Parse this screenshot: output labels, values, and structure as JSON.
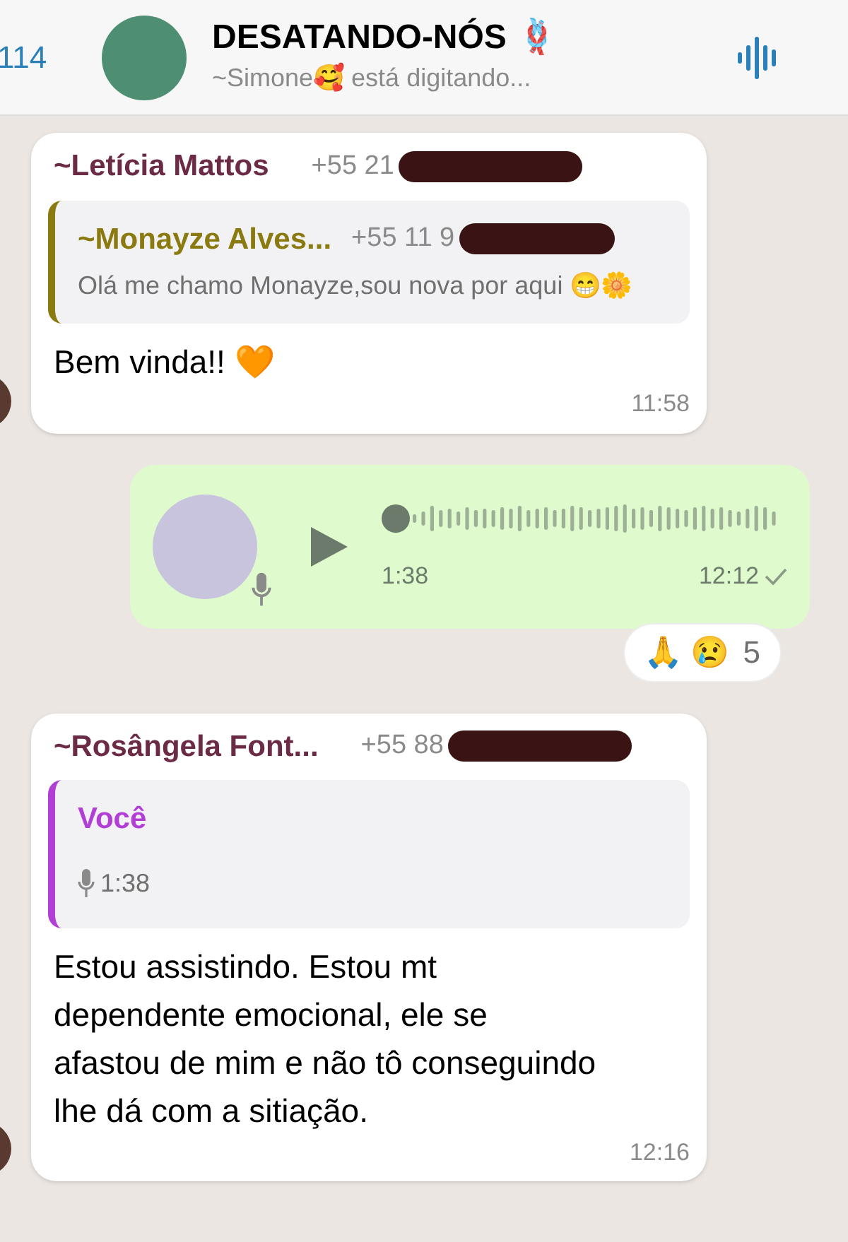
{
  "header": {
    "back_count": "114",
    "title": "DESATANDO-NÓS 🪢",
    "subtitle": "~Simone🥰 está digitando..."
  },
  "messages": [
    {
      "kind": "text",
      "sender": "~Letícia Mattos",
      "phone": "+55 21",
      "quote": {
        "sender": "~Monayze Alves...",
        "phone": "+55 11 9",
        "text": "Olá me chamo Monayze,sou nova por aqui 😁🌼",
        "color": "#8a7a10"
      },
      "text": "Bem vinda!! 🧡",
      "time": "11:58"
    },
    {
      "kind": "voice",
      "duration": "1:38",
      "time": "12:12",
      "read": false,
      "reactions": "🙏 😢",
      "reaction_count": "5"
    },
    {
      "kind": "text",
      "sender": "~Rosângela Font...",
      "phone": "+55 88",
      "quote": {
        "sender": "Você",
        "voice_duration": "1:38",
        "color": "#b13fd6"
      },
      "text": "Estou assistindo. Estou mt dependente emocional, ele se afastou de mim e não tô conseguindo lhe dá com a sitiação.",
      "time": "12:16"
    }
  ]
}
